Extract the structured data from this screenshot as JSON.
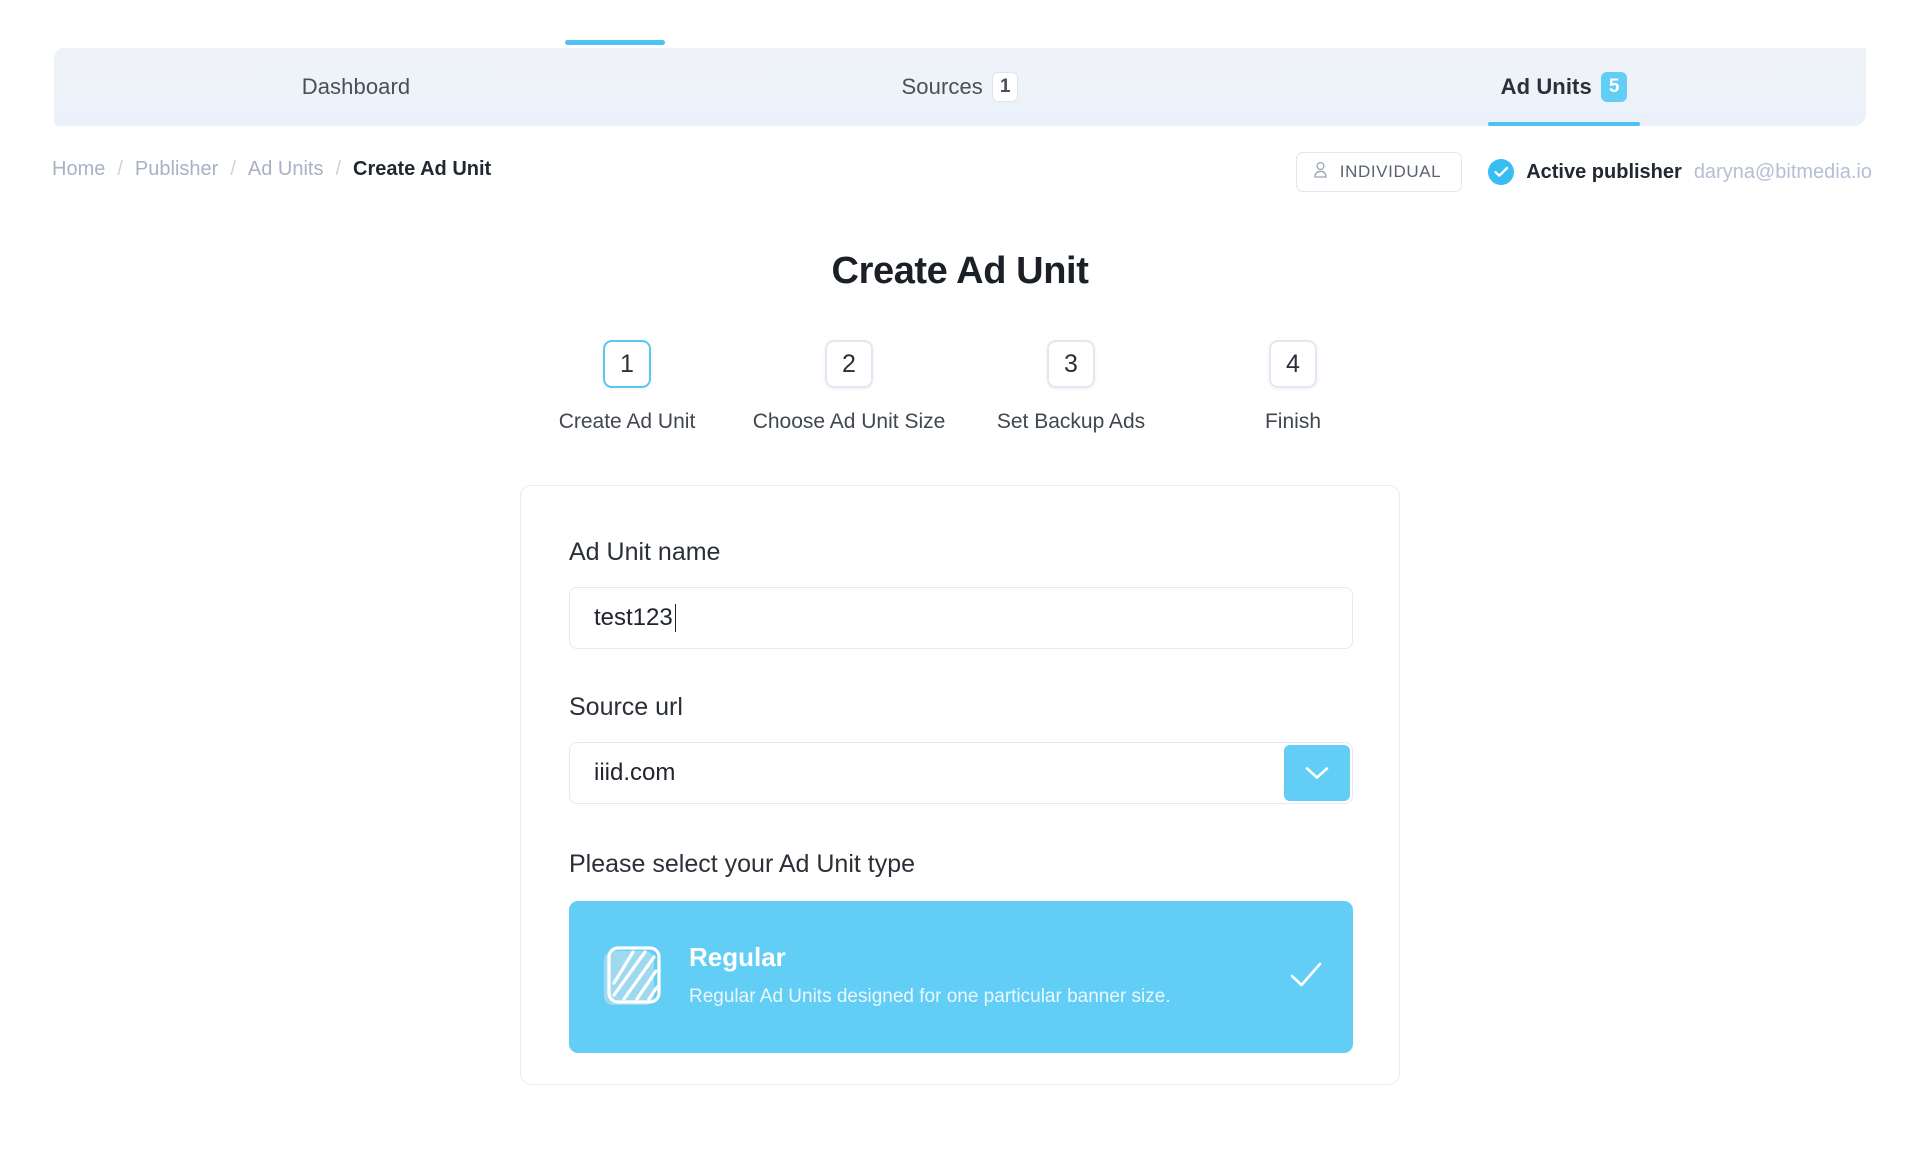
{
  "tabs": [
    {
      "label": "Dashboard",
      "badge": null,
      "active": false
    },
    {
      "label": "Sources",
      "badge": "1",
      "active": false
    },
    {
      "label": "Ad Units",
      "badge": "5",
      "active": true
    }
  ],
  "breadcrumb": {
    "items": [
      "Home",
      "Publisher",
      "Ad Units",
      "Create Ad Unit"
    ],
    "separator": "/"
  },
  "header": {
    "account_type": "INDIVIDUAL",
    "account_icon": "person-icon",
    "status_icon": "verified-check-icon",
    "status_label": "Active publisher",
    "email": "daryna@bitmedia.io"
  },
  "page": {
    "title": "Create Ad Unit"
  },
  "stepper": {
    "steps": [
      {
        "number": "1",
        "label": "Create Ad Unit",
        "active": true
      },
      {
        "number": "2",
        "label": "Choose Ad Unit Size",
        "active": false
      },
      {
        "number": "3",
        "label": "Set Backup Ads",
        "active": false
      },
      {
        "number": "4",
        "label": "Finish",
        "active": false
      }
    ]
  },
  "form": {
    "name_label": "Ad Unit name",
    "name_value": "test123",
    "name_placeholder": "Ad Unit name",
    "source_label": "Source url",
    "source_value": "iiid.com",
    "source_dropdown_icon": "chevron-down-icon",
    "type_heading": "Please select your Ad Unit type",
    "types": [
      {
        "title": "Regular",
        "description": "Regular Ad Units designed for one particular banner size.",
        "icon": "striped-banner-icon",
        "selected": true,
        "check_icon": "check-icon"
      }
    ]
  },
  "colors": {
    "accent": "#62cdf5",
    "accent_line": "#4cc3f2",
    "text_dark": "#222831",
    "text_muted": "#a9b1c6",
    "card_border": "#e8ebf1"
  }
}
